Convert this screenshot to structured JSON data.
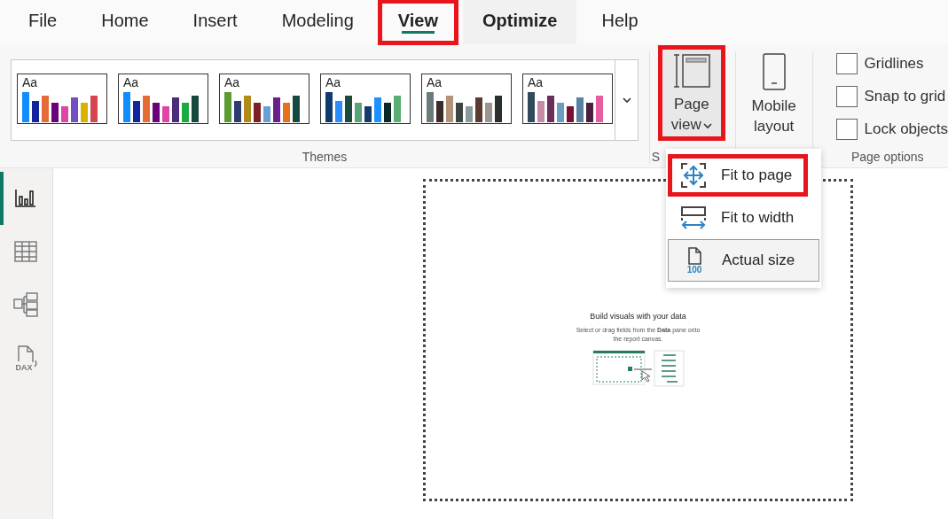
{
  "tabs": [
    {
      "label": "File",
      "selected": false,
      "highlighted": false,
      "emphasized": false
    },
    {
      "label": "Home",
      "selected": false,
      "highlighted": false,
      "emphasized": false
    },
    {
      "label": "Insert",
      "selected": false,
      "highlighted": false,
      "emphasized": false
    },
    {
      "label": "Modeling",
      "selected": false,
      "highlighted": false,
      "emphasized": false
    },
    {
      "label": "View",
      "selected": true,
      "highlighted": true,
      "emphasized": false
    },
    {
      "label": "Optimize",
      "selected": false,
      "highlighted": false,
      "emphasized": true
    },
    {
      "label": "Help",
      "selected": false,
      "highlighted": false,
      "emphasized": false
    }
  ],
  "themes": {
    "label": "Themes",
    "items": [
      {
        "sample_text": "Aa",
        "bars": [
          {
            "color": "#118dff"
          },
          {
            "color": "#12239e"
          },
          {
            "color": "#e66c37"
          },
          {
            "color": "#6b007b"
          },
          {
            "color": "#e044a7"
          },
          {
            "color": "#744ec2"
          },
          {
            "color": "#d9b300"
          },
          {
            "color": "#d64550"
          }
        ]
      },
      {
        "sample_text": "Aa",
        "bars": [
          {
            "color": "#118dff"
          },
          {
            "color": "#12239e"
          },
          {
            "color": "#e66c37"
          },
          {
            "color": "#6b007b"
          },
          {
            "color": "#e044a7"
          },
          {
            "color": "#4a2c79"
          },
          {
            "color": "#1aab40"
          },
          {
            "color": "#15483e"
          }
        ]
      },
      {
        "sample_text": "Aa",
        "bars": [
          {
            "color": "#5b9b31"
          },
          {
            "color": "#2c3e70"
          },
          {
            "color": "#b08b1c"
          },
          {
            "color": "#7c1e26"
          },
          {
            "color": "#6a9fd4"
          },
          {
            "color": "#6b1f8a"
          },
          {
            "color": "#e5711f"
          },
          {
            "color": "#15483e"
          }
        ]
      },
      {
        "sample_text": "Aa",
        "bars": [
          {
            "color": "#0e3b6e"
          },
          {
            "color": "#2a8bff"
          },
          {
            "color": "#1a4a3c"
          },
          {
            "color": "#5aa37a"
          },
          {
            "color": "#123d6b"
          },
          {
            "color": "#1e90ff"
          },
          {
            "color": "#0a2825"
          },
          {
            "color": "#5cad75"
          }
        ]
      },
      {
        "sample_text": "Aa",
        "bars": [
          {
            "color": "#6b7b7b"
          },
          {
            "color": "#3d2c28"
          },
          {
            "color": "#b2937a"
          },
          {
            "color": "#3e4444"
          },
          {
            "color": "#8a9a9a"
          },
          {
            "color": "#5b3a30"
          },
          {
            "color": "#9a9590"
          },
          {
            "color": "#2a2e2c"
          }
        ]
      },
      {
        "sample_text": "Aa",
        "bars": [
          {
            "color": "#334a5c"
          },
          {
            "color": "#c98aa8"
          },
          {
            "color": "#6b2d5c"
          },
          {
            "color": "#6a9ec4"
          },
          {
            "color": "#7a1035"
          },
          {
            "color": "#5a82a0"
          },
          {
            "color": "#4a1f40"
          },
          {
            "color": "#e85ca0"
          }
        ]
      }
    ]
  },
  "scale_group": {
    "label": "S",
    "page_view": {
      "label": "Page view",
      "highlighted": true
    },
    "mobile_layout": {
      "label": "Mobile layout"
    }
  },
  "page_options": {
    "label": "Page options",
    "checkboxes": [
      {
        "label": "Gridlines",
        "checked": false
      },
      {
        "label": "Snap to grid",
        "checked": false
      },
      {
        "label": "Lock objects",
        "checked": false
      }
    ]
  },
  "view_menu": [
    {
      "kind": "fit-page",
      "label": "Fit to page",
      "selected": false,
      "highlighted": true
    },
    {
      "kind": "fit-width",
      "label": "Fit to width",
      "selected": false,
      "highlighted": false
    },
    {
      "kind": "actual-size",
      "label": "Actual size",
      "selected": true,
      "highlighted": false,
      "badge": "100"
    }
  ],
  "sidebar": {
    "items": [
      {
        "kind": "report",
        "selected": true
      },
      {
        "kind": "table",
        "selected": false
      },
      {
        "kind": "model",
        "selected": false
      },
      {
        "kind": "dax",
        "selected": false,
        "badge": "DAX"
      }
    ]
  },
  "canvas": {
    "title": "Build visuals with your data",
    "text": "Select or drag fields from the **Data** pane onto the report canvas."
  }
}
